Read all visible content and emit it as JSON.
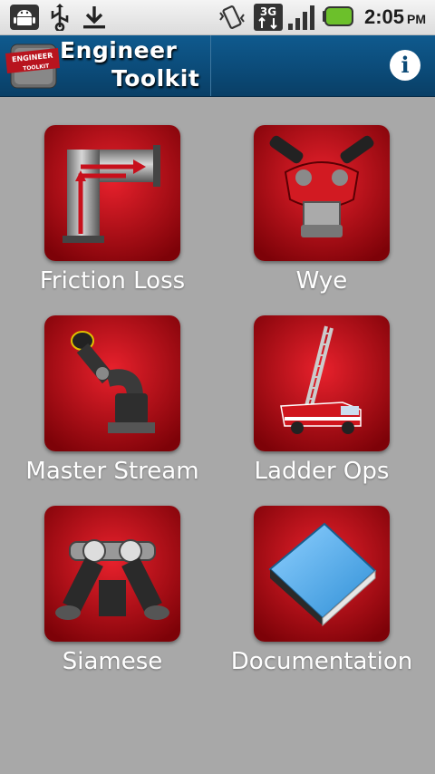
{
  "status_bar": {
    "time": "2:05",
    "ampm": "PM",
    "icons": [
      "android-debug-icon",
      "usb-icon",
      "download-icon",
      "vibrate-icon",
      "3g-data-icon",
      "signal-icon",
      "battery-icon"
    ],
    "network_label": "3G",
    "battery_color": "#6cc02b"
  },
  "action_bar": {
    "title_line1": "Engineer",
    "title_line2": "Toolkit",
    "logo_text_top": "ENGINEER",
    "logo_text_bottom": "TOOLKIT",
    "info_label": "i",
    "background": "#0b4a77"
  },
  "menu": {
    "items": [
      {
        "label": "Friction Loss",
        "icon": "pipe-arrow-icon"
      },
      {
        "label": "Wye",
        "icon": "wye-valve-icon"
      },
      {
        "label": "Master Stream",
        "icon": "master-stream-nozzle-icon"
      },
      {
        "label": "Ladder Ops",
        "icon": "ladder-truck-icon"
      },
      {
        "label": "Siamese",
        "icon": "siamese-valve-icon"
      },
      {
        "label": "Documentation",
        "icon": "book-icon"
      }
    ],
    "tile_color": "#c8101c"
  }
}
